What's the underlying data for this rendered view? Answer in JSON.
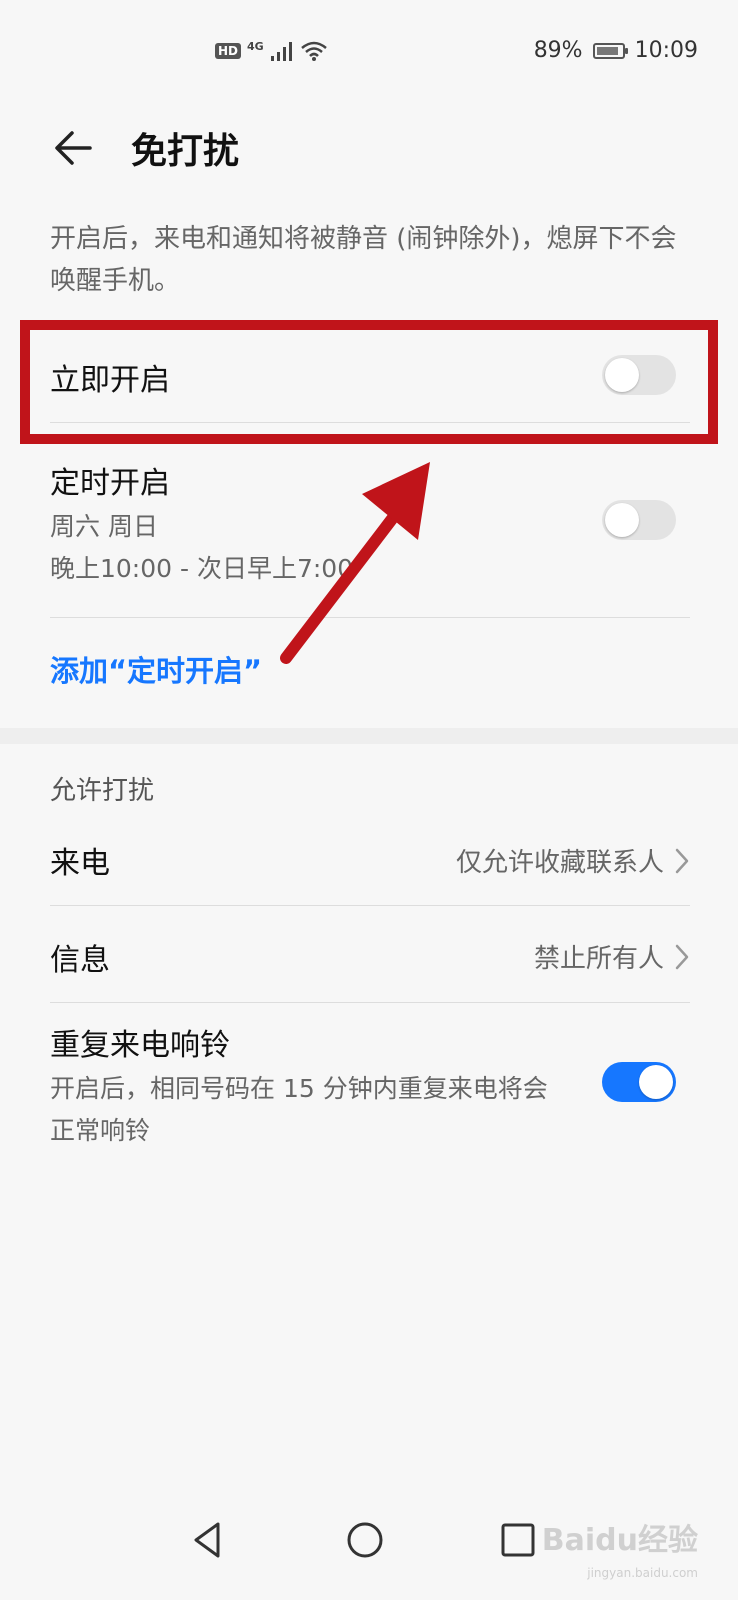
{
  "status_bar": {
    "hd": "HD",
    "network": "4G",
    "battery": "89%",
    "battery_level": 0.89,
    "time": "10:09",
    "icons": [
      "hd-icon",
      "signal-icon",
      "wifi-icon",
      "battery-icon"
    ]
  },
  "header": {
    "title": "免打扰",
    "back_icon": "back-arrow-icon"
  },
  "description": "开启后，来电和通知将被静音 (闹钟除外)，熄屏下不会唤醒手机。",
  "immediate": {
    "label": "立即开启",
    "enabled": false
  },
  "scheduled": {
    "label": "定时开启",
    "days": "周六 周日",
    "time_range": "晚上10:00 - 次日早上7:00",
    "enabled": false
  },
  "add_schedule": "添加“定时开启”",
  "allow_section": {
    "title": "允许打扰",
    "calls": {
      "label": "来电",
      "value": "仅允许收藏联系人"
    },
    "messages": {
      "label": "信息",
      "value": "禁止所有人"
    },
    "repeat_calls": {
      "label": "重复来电响铃",
      "description": "开启后，相同号码在 15 分钟内重复来电将会正常响铃",
      "enabled": true
    }
  },
  "nav_bar": {
    "icons": [
      "nav-back-icon",
      "nav-home-icon",
      "nav-recents-icon"
    ]
  },
  "watermark": {
    "brand": "Baidu经验",
    "url": "jingyan.baidu.com"
  },
  "colors": {
    "accent": "#1677ff",
    "annotation": "#c0141a",
    "toggle_off": "#e3e3e3"
  }
}
